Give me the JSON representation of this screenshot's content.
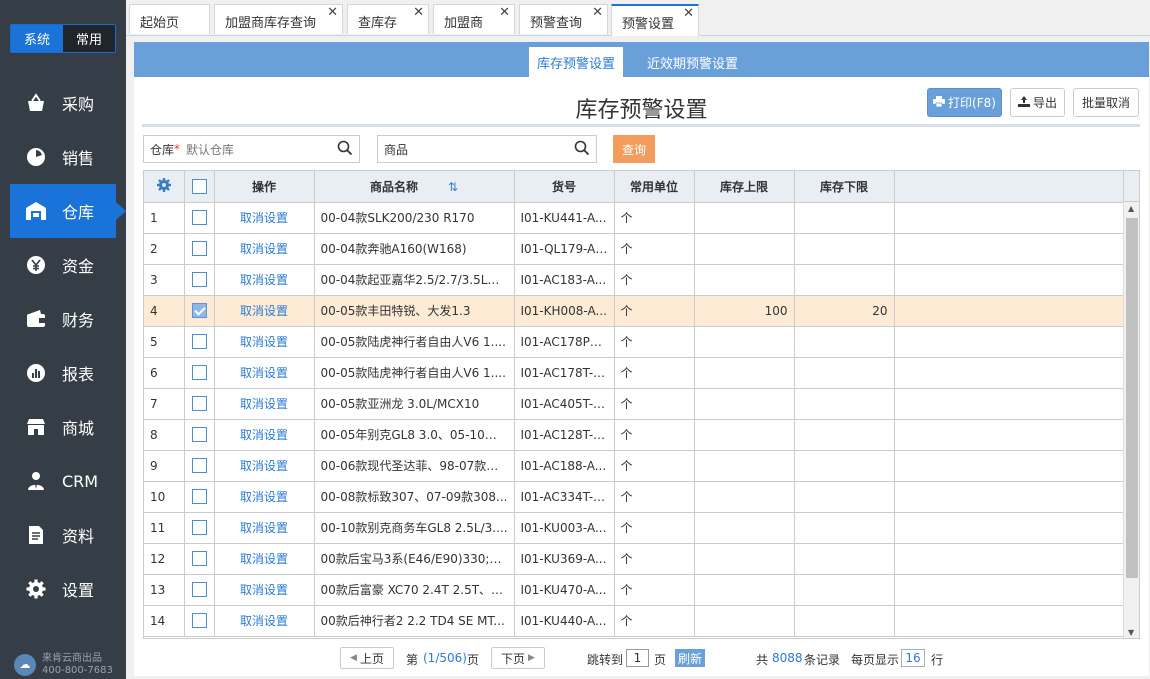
{
  "sidebar": {
    "switch": {
      "system": "系统",
      "common": "常用"
    },
    "items": [
      {
        "label": "采购",
        "icon": "basket-icon",
        "active": false
      },
      {
        "label": "销售",
        "icon": "sales-icon",
        "active": false
      },
      {
        "label": "仓库",
        "icon": "warehouse-icon",
        "active": true
      },
      {
        "label": "资金",
        "icon": "yen-icon",
        "active": false
      },
      {
        "label": "财务",
        "icon": "wallet-icon",
        "active": false
      },
      {
        "label": "报表",
        "icon": "report-icon",
        "active": false
      },
      {
        "label": "商城",
        "icon": "store-icon",
        "active": false
      },
      {
        "label": "CRM",
        "icon": "crm-icon",
        "active": false
      },
      {
        "label": "资料",
        "icon": "document-icon",
        "active": false
      },
      {
        "label": "设置",
        "icon": "gear-icon",
        "active": false
      }
    ],
    "brand": {
      "name": "来肯云商出品",
      "phone": "400-800-7683"
    }
  },
  "tabs": [
    {
      "label": "起始页",
      "closable": false
    },
    {
      "label": "加盟商库存查询",
      "closable": true
    },
    {
      "label": "查库存",
      "closable": true
    },
    {
      "label": "加盟商",
      "closable": true
    },
    {
      "label": "预警查询",
      "closable": true
    },
    {
      "label": "预警设置",
      "closable": true,
      "active": true
    }
  ],
  "subtabs": {
    "stock_alert": "库存预警设置",
    "expiry_alert": "近效期预警设置"
  },
  "page": {
    "title": "库存预警设置"
  },
  "toolbar": {
    "print": "打印(F8)",
    "export": "导出",
    "batch_cancel": "批量取消"
  },
  "filters": {
    "warehouse_label": "仓库",
    "required_mark": "*",
    "warehouse_value": "默认仓库",
    "product_placeholder": "商品",
    "query": "查询"
  },
  "table": {
    "headers": {
      "op": "操作",
      "name": "商品名称",
      "code": "货号",
      "unit": "常用单位",
      "upper": "库存上限",
      "lower": "库存下限"
    },
    "rows": [
      {
        "no": "1",
        "checked": false,
        "op": "取消设置",
        "name": "00-04款SLK200/230 R170",
        "code": "I01-KU441-A...",
        "unit": "个",
        "upper": "",
        "lower": ""
      },
      {
        "no": "2",
        "checked": false,
        "op": "取消设置",
        "name": "00-04款奔驰A160(W168)",
        "code": "I01-QL179-AS...",
        "unit": "个",
        "upper": "",
        "lower": ""
      },
      {
        "no": "3",
        "checked": false,
        "op": "取消设置",
        "name": "00-04款起亚嘉华2.5/2.7/3.5L、...",
        "code": "I01-AC183-A...",
        "unit": "个",
        "upper": "",
        "lower": ""
      },
      {
        "no": "4",
        "checked": true,
        "op": "取消设置",
        "name": "00-05款丰田特锐、大发1.3",
        "code": "I01-KH008-A...",
        "unit": "个",
        "upper": "100",
        "lower": "20"
      },
      {
        "no": "5",
        "checked": false,
        "op": "取消设置",
        "name": "00-05款陆虎神行者自由人V6 1....",
        "code": "I01-AC178PT-...",
        "unit": "个",
        "upper": "",
        "lower": ""
      },
      {
        "no": "6",
        "checked": false,
        "op": "取消设置",
        "name": "00-05款陆虎神行者自由人V6 1....",
        "code": "I01-AC178T-A...",
        "unit": "个",
        "upper": "",
        "lower": ""
      },
      {
        "no": "7",
        "checked": false,
        "op": "取消设置",
        "name": "00-05款亚洲龙 3.0L/MCX10",
        "code": "I01-AC405T-A...",
        "unit": "个",
        "upper": "",
        "lower": ""
      },
      {
        "no": "8",
        "checked": false,
        "op": "取消设置",
        "name": "00-05年别克GL8 3.0、05-10年...",
        "code": "I01-AC128T-A...",
        "unit": "个",
        "upper": "",
        "lower": ""
      },
      {
        "no": "9",
        "checked": false,
        "op": "取消设置",
        "name": "00-06款现代圣达菲、98-07款索...",
        "code": "I01-AC188-A...",
        "unit": "个",
        "upper": "",
        "lower": ""
      },
      {
        "no": "10",
        "checked": false,
        "op": "取消设置",
        "name": "00-08款标致307、07-09款308...",
        "code": "I01-AC334T-A...",
        "unit": "个",
        "upper": "",
        "lower": ""
      },
      {
        "no": "11",
        "checked": false,
        "op": "取消设置",
        "name": "00-10款别克商务车GL8 2.5L/3....",
        "code": "I01-KU003-A...",
        "unit": "个",
        "upper": "",
        "lower": ""
      },
      {
        "no": "12",
        "checked": false,
        "op": "取消设置",
        "name": "00款后宝马3系(E46/E90)330;宝...",
        "code": "I01-KU369-A...",
        "unit": "个",
        "upper": "",
        "lower": ""
      },
      {
        "no": "13",
        "checked": false,
        "op": "取消设置",
        "name": "00款后富豪 XC70 2.4T 2.5T、0...",
        "code": "I01-KU470-A...",
        "unit": "个",
        "upper": "",
        "lower": ""
      },
      {
        "no": "14",
        "checked": false,
        "op": "取消设置",
        "name": "00款后神行者2 2.2 TD4 SE MT...",
        "code": "I01-KU440-A...",
        "unit": "个",
        "upper": "",
        "lower": ""
      }
    ]
  },
  "pager": {
    "prev": "上页",
    "page_prefix": "第",
    "page_info": "(1/506)",
    "page_suffix": "页",
    "next": "下页",
    "jump_prefix": "跳转到",
    "jump_value": "1",
    "jump_suffix": "页",
    "refresh": "刷新",
    "total_prefix": "共",
    "total": "8088",
    "total_suffix": "条记录",
    "per_page_prefix": "每页显示",
    "per_page": "16",
    "per_page_suffix": "行"
  },
  "colors": {
    "accent": "#1a73d9",
    "subbar": "#6aa0d9",
    "query": "#f39c5c",
    "selected_row": "#fdebd6",
    "sidebar": "#353d46"
  }
}
